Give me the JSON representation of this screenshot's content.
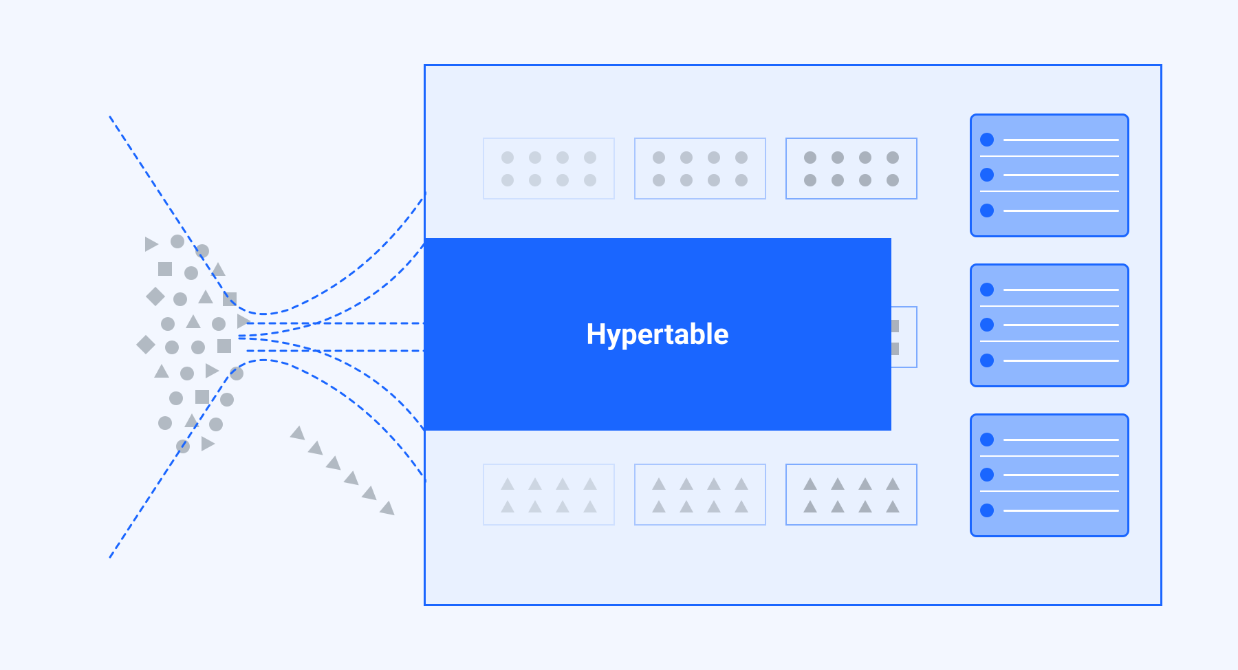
{
  "diagram": {
    "title": "Hypertable",
    "chunk_rows": {
      "top": {
        "shape": "circle",
        "opacities": [
          "o1",
          "o2",
          "o3"
        ]
      },
      "middle": {
        "shape": "square",
        "opacities": [
          "o1",
          "o2",
          "o3"
        ]
      },
      "bottom": {
        "shape": "triangle",
        "opacities": [
          "o1",
          "o2",
          "o3"
        ]
      }
    },
    "shapes_per_chunk": 8,
    "result_cards": 3,
    "result_rows_per_card": 3,
    "colors": {
      "bg": "#f3f7ff",
      "primary": "#1a66ff",
      "panel": "#e9f1ff",
      "result_fill": "#8fb7ff",
      "shape_gray": "#9aa3ad"
    }
  }
}
